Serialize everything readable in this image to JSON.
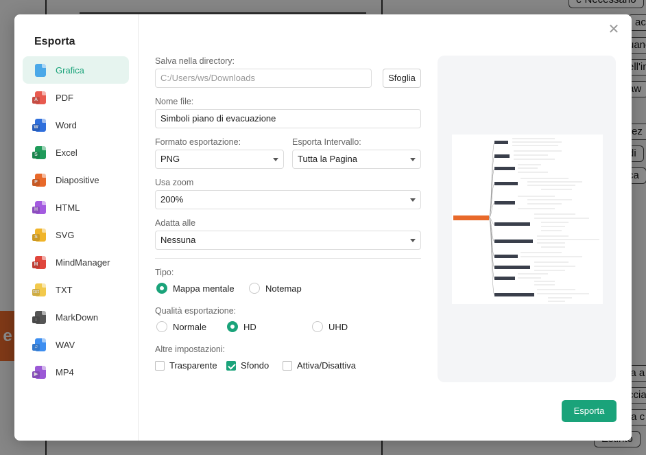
{
  "background": {
    "nodes": [
      "e Necessario",
      "acc",
      "uano",
      "ell'in",
      "aw",
      "rez",
      "di",
      "ca",
      "la a",
      "ccia",
      "ta c",
      "Estinto"
    ],
    "tab_letter": "e"
  },
  "dialog": {
    "title": "Esporta",
    "close_icon": "close-icon",
    "menu": [
      {
        "label": "Grafica",
        "icon": "image-icon",
        "color": "#4aa8e8",
        "badge": ""
      },
      {
        "label": "PDF",
        "icon": "pdf-icon",
        "color": "#e85a4f",
        "badge": "A"
      },
      {
        "label": "Word",
        "icon": "word-icon",
        "color": "#2f6fdc",
        "badge": "W"
      },
      {
        "label": "Excel",
        "icon": "excel-icon",
        "color": "#1f9b5a",
        "badge": "S"
      },
      {
        "label": "Diapositive",
        "icon": "slides-icon",
        "color": "#e8692a",
        "badge": "P"
      },
      {
        "label": "HTML",
        "icon": "html-icon",
        "color": "#a45be0",
        "badge": "H"
      },
      {
        "label": "SVG",
        "icon": "svg-icon",
        "color": "#f0b429",
        "badge": "S"
      },
      {
        "label": "MindManager",
        "icon": "mindmanager-icon",
        "color": "#e0463c",
        "badge": "M"
      },
      {
        "label": "TXT",
        "icon": "txt-icon",
        "color": "#f2c94c",
        "badge": "txt"
      },
      {
        "label": "MarkDown",
        "icon": "markdown-icon",
        "color": "#555555",
        "badge": "↓"
      },
      {
        "label": "WAV",
        "icon": "wav-icon",
        "color": "#3d8ef0",
        "badge": "♫"
      },
      {
        "label": "MP4",
        "icon": "mp4-icon",
        "color": "#9b59d6",
        "badge": "▶"
      }
    ],
    "form": {
      "dir_label": "Salva nella directory:",
      "dir_value": "C:/Users/ws/Downloads",
      "browse_label": "Sfoglia",
      "filename_label": "Nome file:",
      "filename_value": "Simboli piano di evacuazione",
      "format_label": "Formato esportazione:",
      "format_value": "PNG",
      "range_label": "Esporta Intervallo:",
      "range_value": "Tutta la Pagina",
      "zoom_label": "Usa zoom",
      "zoom_value": "200%",
      "fit_label": "Adatta alle",
      "fit_value": "Nessuna",
      "type_label": "Tipo:",
      "type_options": [
        "Mappa mentale",
        "Notemap"
      ],
      "type_selected": "Mappa mentale",
      "quality_label": "Qualità esportazione:",
      "quality_options": [
        "Normale",
        "HD",
        "UHD"
      ],
      "quality_selected": "HD",
      "other_label": "Altre impostazioni:",
      "other_options": [
        {
          "label": "Trasparente",
          "checked": false
        },
        {
          "label": "Sfondo",
          "checked": true
        },
        {
          "label": "Attiva/Disattiva",
          "checked": false
        }
      ]
    },
    "export_label": "Esporta",
    "accent": "#1aa37a"
  }
}
